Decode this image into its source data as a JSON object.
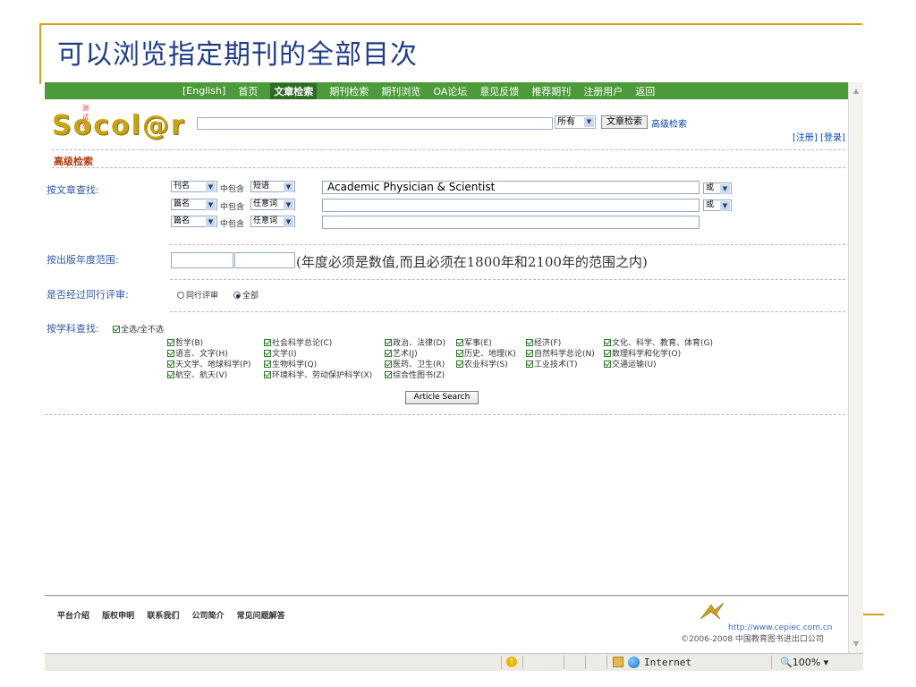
{
  "slide": {
    "title": "可以浏览指定期刊的全部目次"
  },
  "nav": {
    "items": [
      "[English]",
      "首页",
      "文章检索",
      "期刊检索",
      "期刊浏览",
      "OA论坛",
      "意见反馈",
      "推荐期刊",
      "注册用户",
      "返回"
    ],
    "active_index": 2
  },
  "header": {
    "trial_badge": "测试版",
    "logo_text": "Socol@r",
    "search_value": "",
    "scope": "所有",
    "search_button": "文章检索",
    "advanced_link": "高级检索",
    "auth_links": "[注册] [登录]"
  },
  "advanced": {
    "section_title": "高级检索",
    "by_article_label": "按文章查找:",
    "rows": [
      {
        "field": "刊名",
        "contains": "中包含",
        "match": "短语",
        "value": "Academic Physician & Scientist",
        "logic": "或"
      },
      {
        "field": "篇名",
        "contains": "中包含",
        "match": "任意词",
        "value": "",
        "logic": "或"
      },
      {
        "field": "篇名",
        "contains": "中包含",
        "match": "任意词",
        "value": "",
        "logic": ""
      }
    ],
    "year_label": "按出版年度范围:",
    "year_from": "",
    "year_to": "",
    "year_hint": "(年度必须是数值,而且必须在1800年和2100年的范围之内)",
    "peer_label": "是否经过同行评审:",
    "peer_options": [
      "同行评审",
      "全部"
    ],
    "peer_selected": 1,
    "subject_label": "按学科查找:",
    "select_all": "全选/全不选",
    "subjects": [
      "哲学(B)",
      "社会科学总论(C)",
      "政治、法律(D)",
      "军事(E)",
      "经济(F)",
      "文化、科学、教育、体育(G)",
      "语言、文字(H)",
      "文学(I)",
      "艺术(J)",
      "历史、地理(K)",
      "自然科学总论(N)",
      "数理科学和化学(O)",
      "天文学、地球科学(P)",
      "生物科学(Q)",
      "医药、卫生(R)",
      "农业科学(S)",
      "工业技术(T)",
      "交通运输(U)",
      "航空、航天(V)",
      "环境科学、劳动保护科学(X)",
      "综合性图书(Z)"
    ],
    "submit": "Article Search"
  },
  "footer": {
    "links": [
      "平台介绍",
      "版权申明",
      "联系我们",
      "公司简介",
      "常见问题解答"
    ],
    "url": "http://www.cepiec.com.cn",
    "copyright": "©2006-2008 中国教育图书进出口公司"
  },
  "status": {
    "zone": "Internet",
    "zoom": "100%"
  }
}
